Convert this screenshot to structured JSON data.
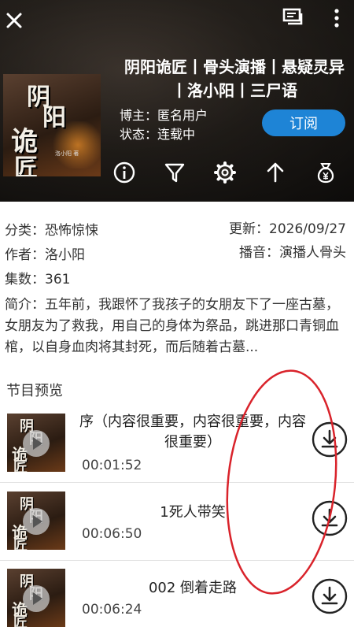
{
  "header": {
    "title": "阴阳诡匠丨骨头演播丨悬疑灵异丨洛小阳丨三尸语",
    "blogger": "博主：匿名用户",
    "status": "状态：连载中",
    "subscribe_label": "订阅",
    "cover_text": [
      "阴",
      "阳",
      "诡",
      "匠"
    ],
    "cover_small_text": "洛小阳 著"
  },
  "icons": {
    "close": "close-icon",
    "chat": "chat-icon",
    "more": "more-vert-icon",
    "actions": [
      "info-icon",
      "filter-icon",
      "settings-icon",
      "arrow-up-icon",
      "money-bag-icon"
    ]
  },
  "info": {
    "category": "分类：恐怖惊悚",
    "author": "作者：洛小阳",
    "episodes": "集数：361",
    "updated": "更新：2026/09/27",
    "narrator": "播音：演播人骨头",
    "synopsis": "简介：五年前，我跟怀了我孩子的女朋友下了一座古墓，女朋友为了救我，用自己的身体为祭品，跳进那口青铜血棺，以自身血肉将其封死，而后随着古墓..."
  },
  "section": {
    "title": "节目预览"
  },
  "episodes": [
    {
      "title": "序（内容很重要，内容很重要，内容很重要）",
      "duration": "00:01:52"
    },
    {
      "title": "1死人带笑",
      "duration": "00:06:50"
    },
    {
      "title": "002 倒着走路",
      "duration": "00:06:24"
    }
  ],
  "colors": {
    "accent": "#1e84d6",
    "annotation": "#d9232b"
  }
}
